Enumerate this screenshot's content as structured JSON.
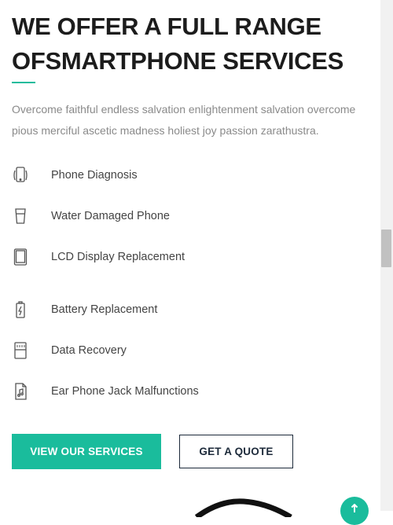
{
  "heading": "WE OFFER A FULL RANGE OFSMARTPHONE SERVICES",
  "intro": "Overcome faithful endless salvation enlightenment salvation overcome pious merciful ascetic madness holiest joy passion zarathustra.",
  "services": [
    {
      "label": "Phone Diagnosis",
      "icon": "phone-diagnosis-icon"
    },
    {
      "label": "Water Damaged Phone",
      "icon": "water-glass-icon"
    },
    {
      "label": "LCD Display Replacement",
      "icon": "tablet-icon"
    },
    {
      "label": "Battery Replacement",
      "icon": "battery-charging-icon"
    },
    {
      "label": "Data Recovery",
      "icon": "sd-card-icon"
    },
    {
      "label": "Ear Phone Jack Malfunctions",
      "icon": "music-file-icon"
    }
  ],
  "buttons": {
    "primary": "VIEW OUR SERVICES",
    "secondary": "GET A QUOTE"
  },
  "colors": {
    "accent": "#1abc9c",
    "heading": "#1c1c1c",
    "outline": "#1c2a3a"
  }
}
